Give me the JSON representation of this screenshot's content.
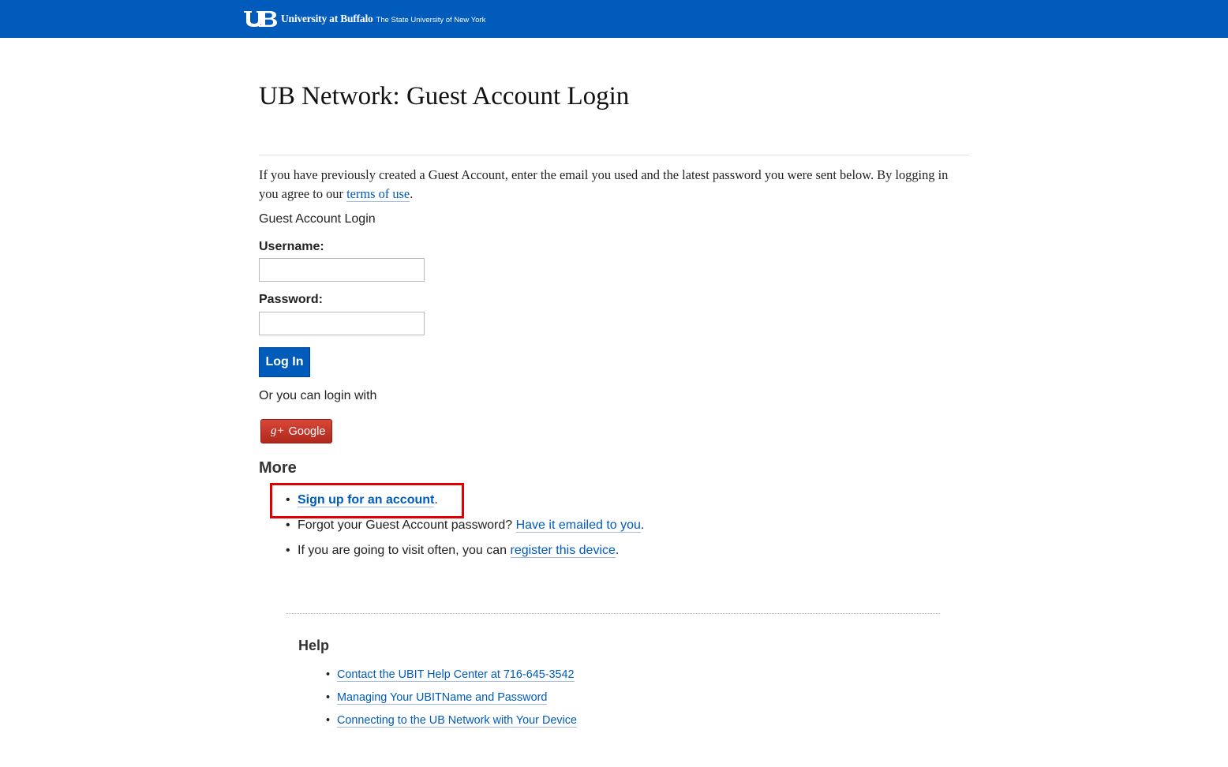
{
  "header": {
    "logo_mark": "UB",
    "brand_name": "University at Buffalo",
    "brand_sub": "The State University of New York",
    "bar_color": "#005bbb"
  },
  "page": {
    "title": "UB Network: Guest Account Login",
    "intro_text": "If you have previously created a Guest Account, enter the email you used and the latest password you were sent below. By logging in you agree to our ",
    "intro_link": "terms of use",
    "intro_end": "."
  },
  "form": {
    "heading": "Guest Account Login",
    "username_label": "Username:",
    "username_value": "",
    "password_label": "Password:",
    "password_value": "",
    "login_button": "Log In",
    "or_text": "Or you can login with",
    "google_icon": "g+",
    "google_button": "Google"
  },
  "more": {
    "heading": "More",
    "items": [
      {
        "prefix": "",
        "link": "Sign up for an account",
        "suffix": "."
      },
      {
        "prefix": "Forgot your Guest Account password? ",
        "link": "Have it emailed to you",
        "suffix": "."
      },
      {
        "prefix": "If you are going to visit often, you can ",
        "link": "register this device",
        "suffix": "."
      }
    ]
  },
  "help": {
    "heading": "Help",
    "links": [
      "Contact the UBIT Help Center at 716-645-3542",
      "Managing Your UBITName and Password",
      "Connecting to the UB Network with Your Device"
    ]
  },
  "colors": {
    "link": "#005bbb",
    "highlight": "#e00000",
    "google": "#c53727"
  }
}
